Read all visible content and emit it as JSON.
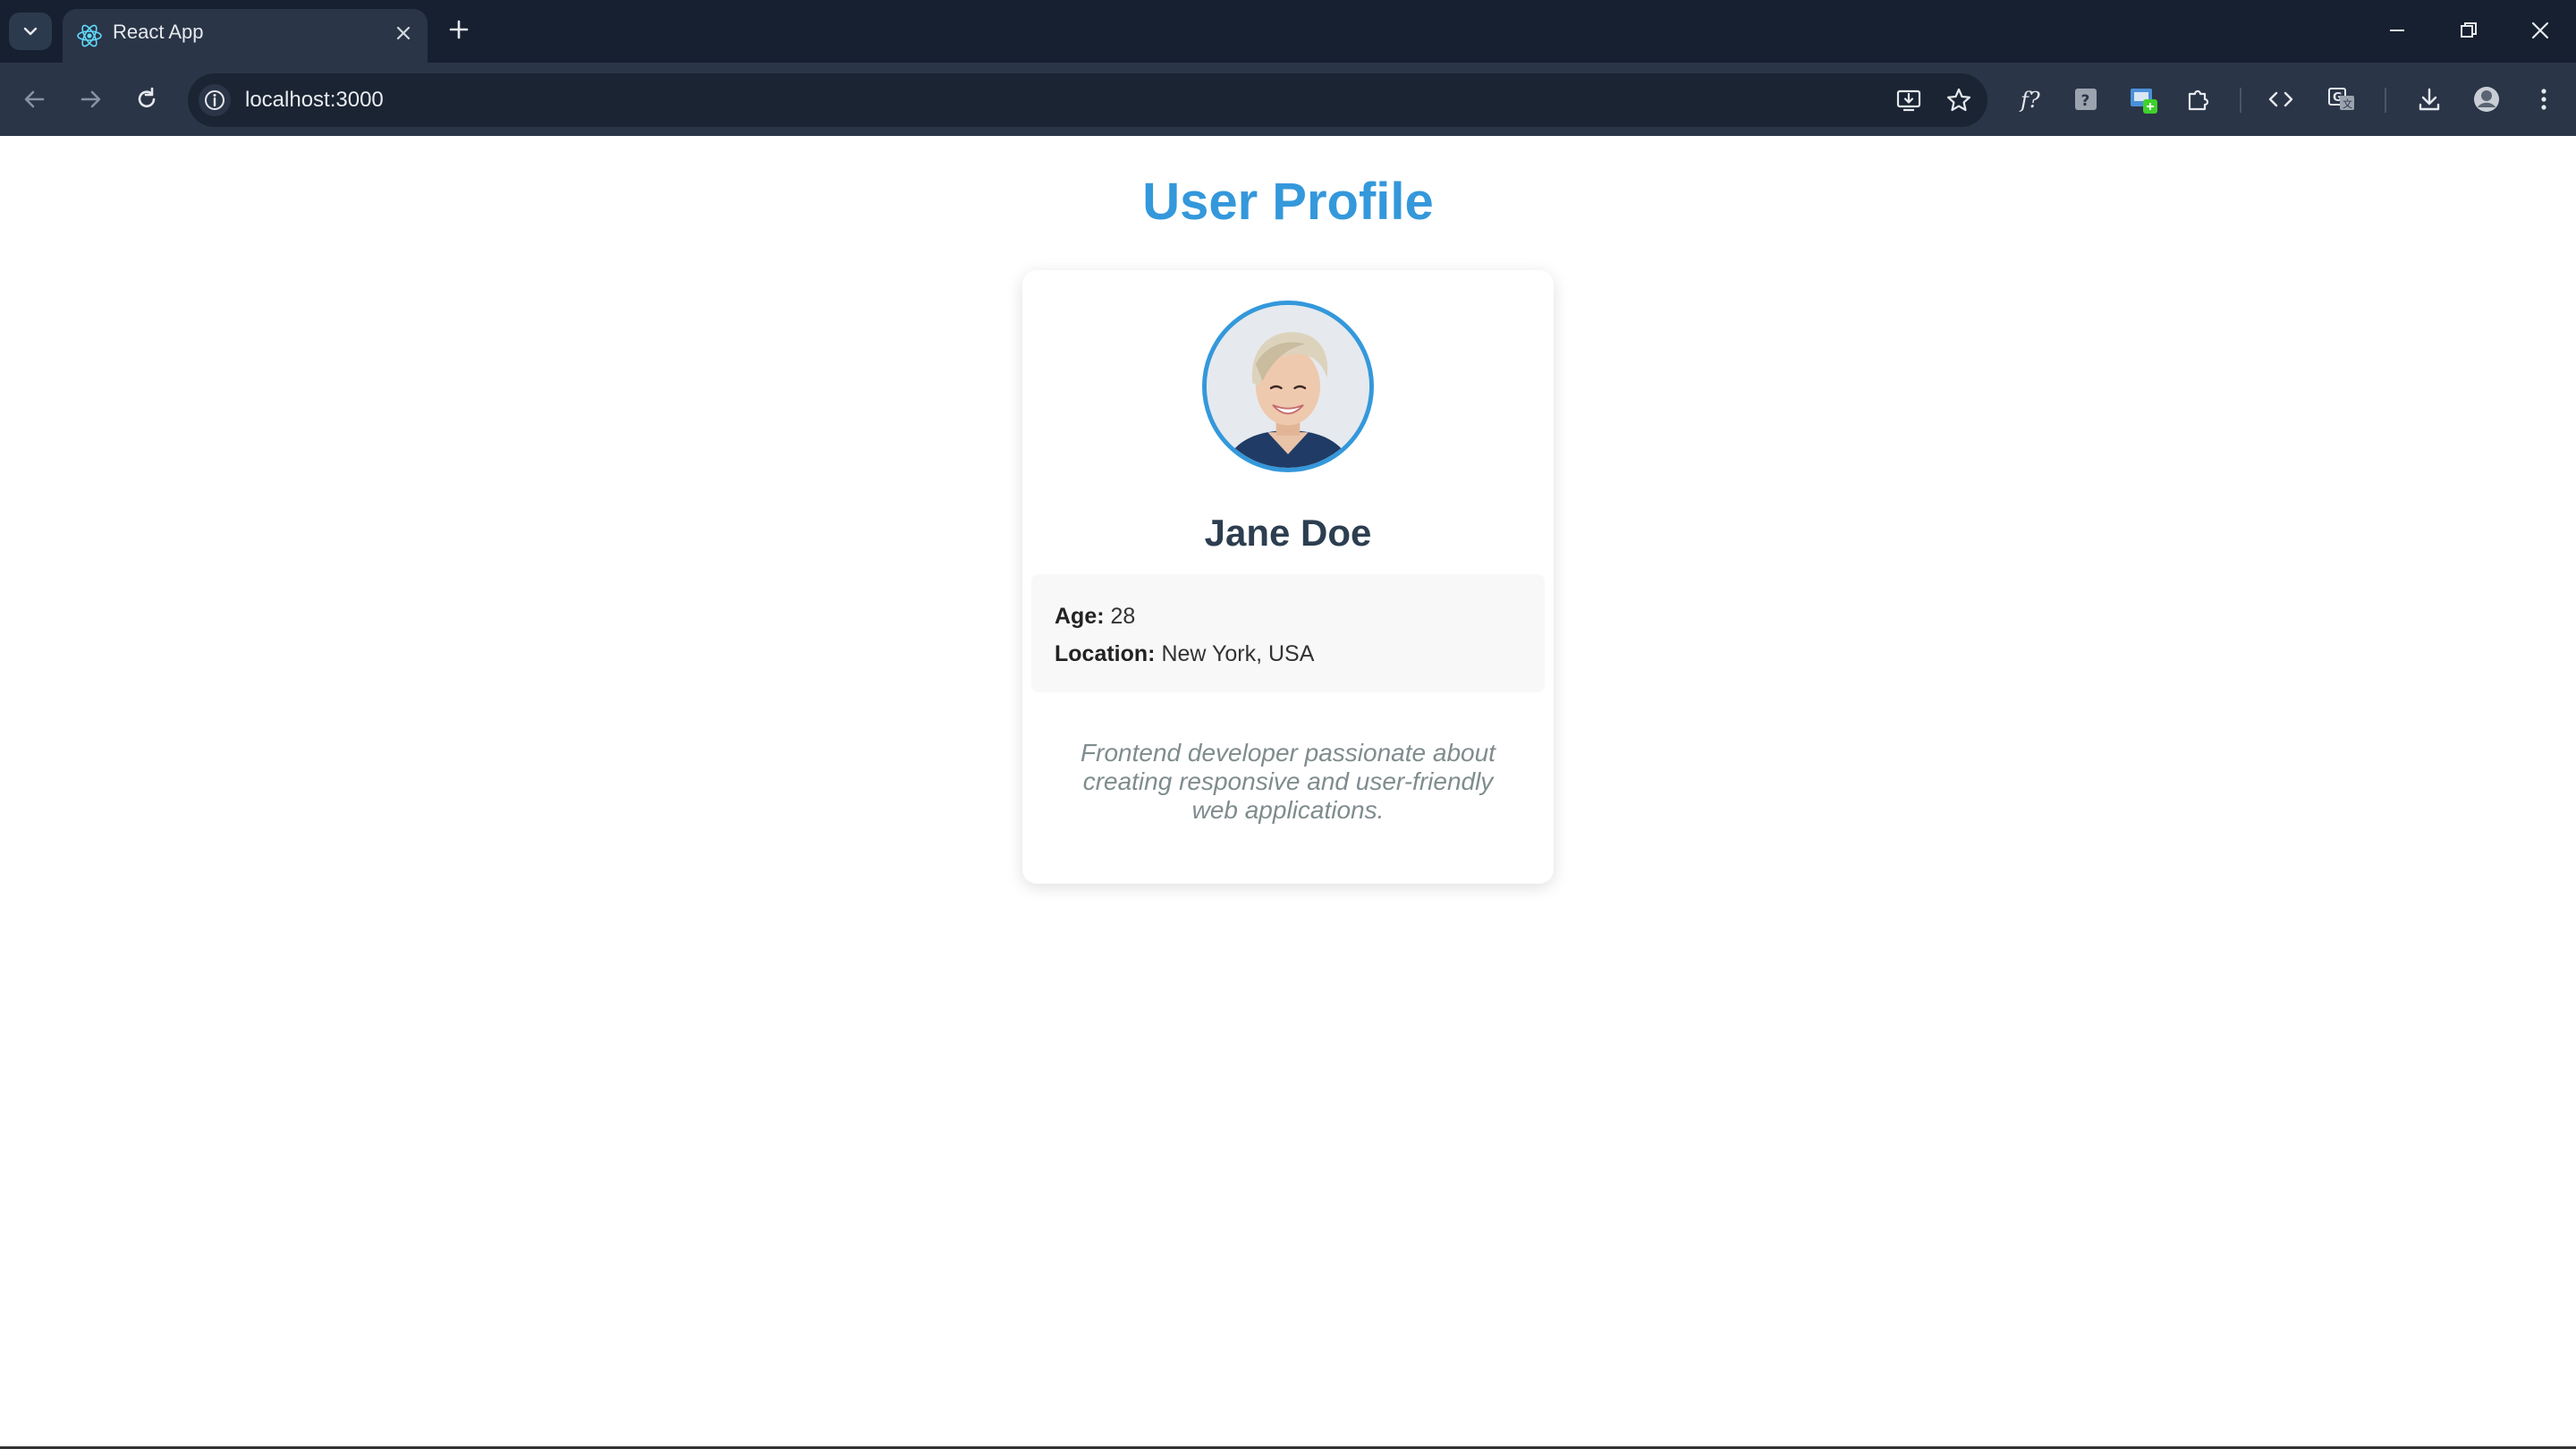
{
  "browser": {
    "tab": {
      "title": "React App",
      "favicon": "react-icon"
    },
    "address_bar": {
      "url": "localhost:3000"
    },
    "icons": {
      "tab_search": "chevron-down-icon",
      "new_tab": "plus-icon",
      "minimize": "minimize-icon",
      "restore": "restore-icon",
      "close": "close-icon",
      "back": "arrow-left-icon",
      "forward": "arrow-right-icon",
      "reload": "reload-icon",
      "site_info": "info-icon",
      "install": "install-app-icon",
      "bookmark": "star-icon",
      "formula_ext": "formula-extension-icon",
      "help_ext": "help-extension-icon",
      "colorpick_ext": "color-extension-icon",
      "extensions": "puzzle-icon",
      "devtools": "code-icon",
      "translate": "translate-icon",
      "downloads": "download-icon",
      "profile": "profile-avatar-icon",
      "menu": "kebab-menu-icon"
    },
    "colors": {
      "frame": "#172030",
      "toolbar": "#2a3547",
      "omnibox": "#1a2433"
    }
  },
  "page": {
    "title": "User Profile",
    "title_color": "#3498db",
    "profile": {
      "name": "Jane Doe",
      "details": [
        {
          "label": "Age:",
          "value": "28"
        },
        {
          "label": "Location:",
          "value": "New York, USA"
        }
      ],
      "bio": "Frontend developer passionate about creating responsive and user-friendly web applications.",
      "avatar_border_color": "#3498db"
    }
  }
}
